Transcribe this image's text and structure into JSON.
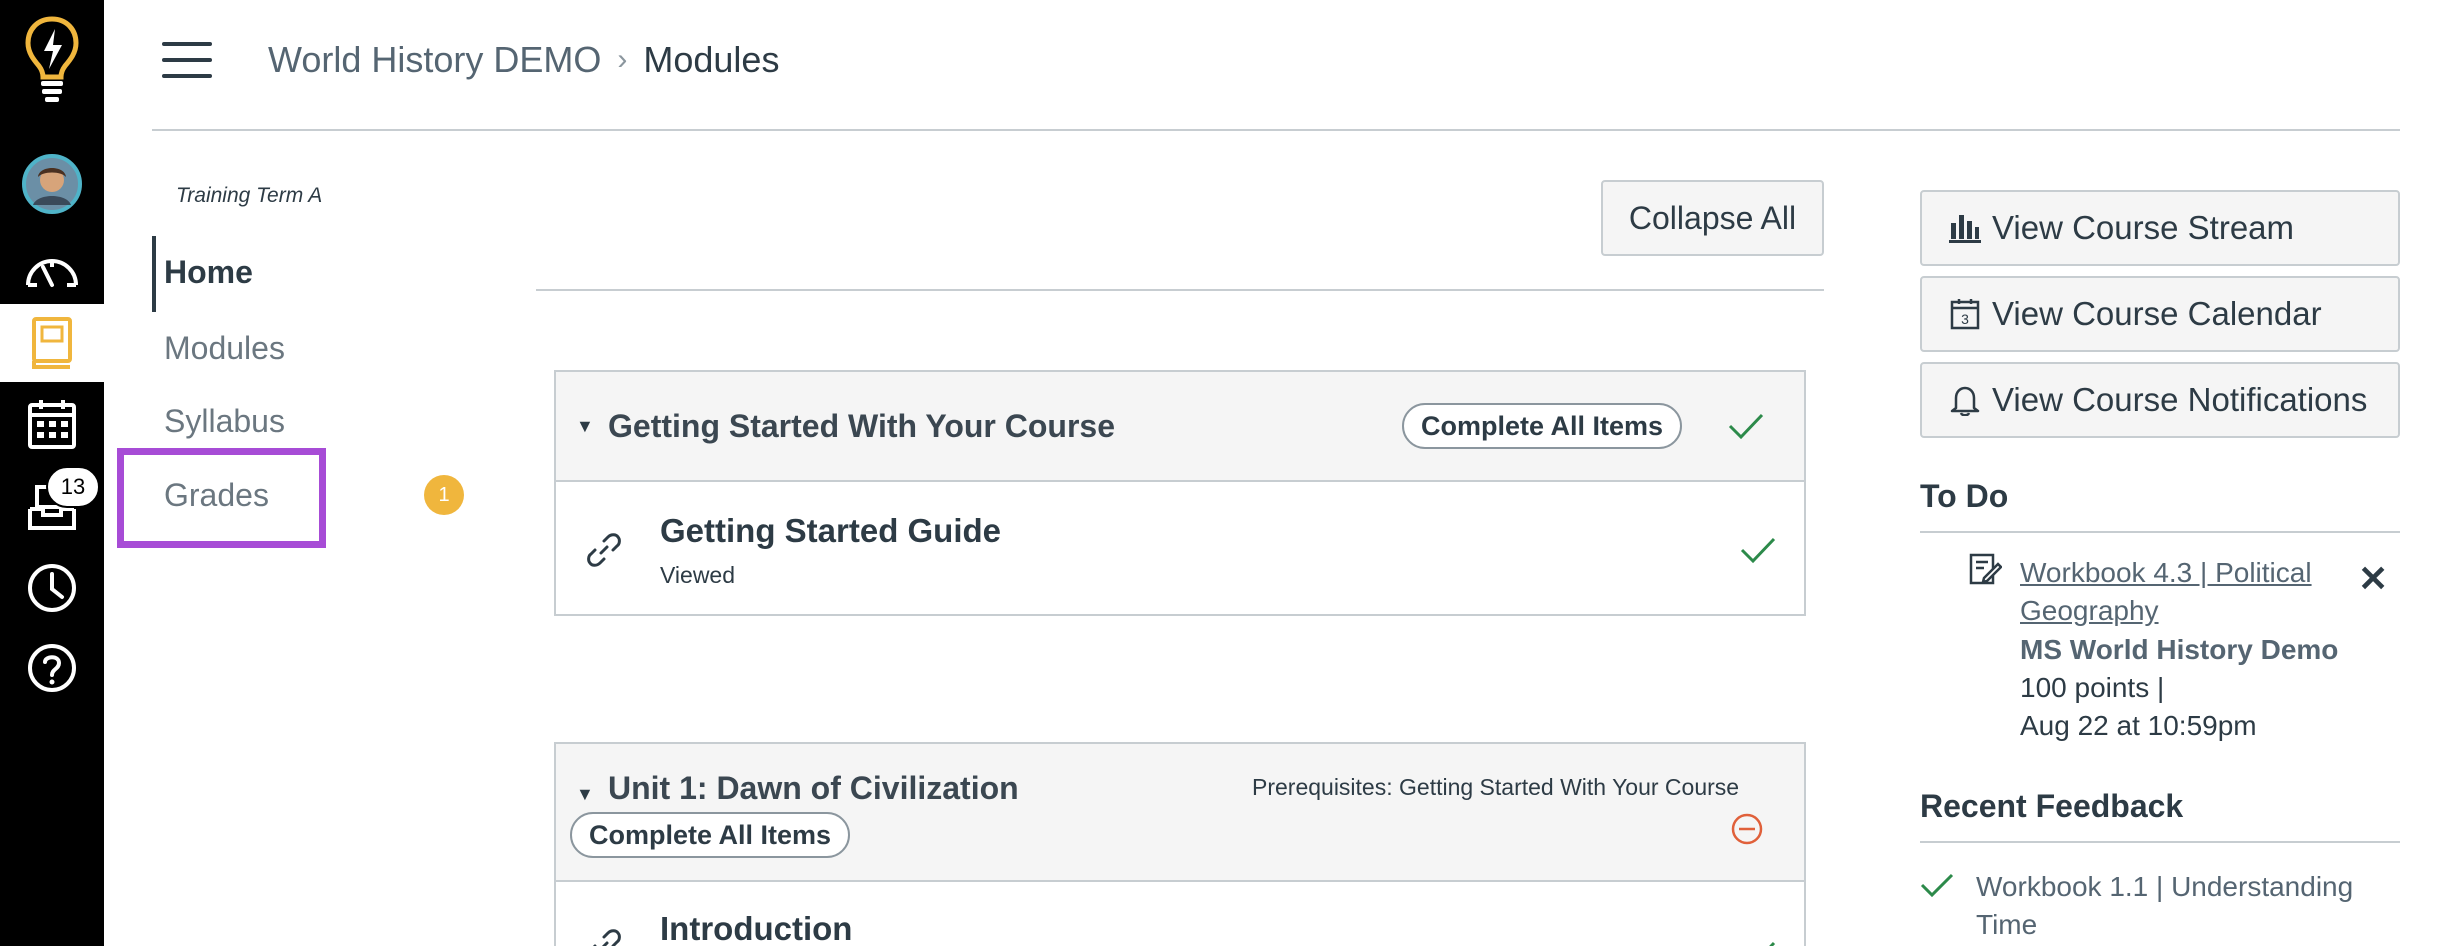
{
  "global_nav": {
    "items": [
      {
        "name": "logo",
        "icon": "lightbulb-icon"
      },
      {
        "name": "account",
        "icon": "avatar"
      },
      {
        "name": "dashboard",
        "icon": "dashboard-gauge-icon"
      },
      {
        "name": "courses",
        "icon": "courses-book-icon"
      },
      {
        "name": "calendar",
        "icon": "calendar-icon"
      },
      {
        "name": "inbox",
        "icon": "inbox-icon"
      },
      {
        "name": "history",
        "icon": "clock-icon"
      },
      {
        "name": "help",
        "icon": "help-circle-icon"
      }
    ],
    "inbox_count": "13",
    "accent_color": "#f0b63d"
  },
  "header": {
    "course": "World History DEMO",
    "separator": "›",
    "current": "Modules"
  },
  "course_nav": {
    "term": "Training Term A",
    "items": [
      {
        "label": "Home"
      },
      {
        "label": "Modules"
      },
      {
        "label": "Syllabus"
      },
      {
        "label": "Grades",
        "badge": "1"
      }
    ],
    "highlight_color": "#a74cd6"
  },
  "main": {
    "collapse_all": "Collapse All",
    "modules": [
      {
        "title": "Getting Started With Your Course",
        "complete_all": "Complete All Items",
        "status": "completed",
        "items": [
          {
            "title": "Getting Started Guide",
            "subtitle": "Viewed",
            "icon": "link-icon",
            "status": "completed"
          }
        ]
      },
      {
        "title": "Unit 1: Dawn of Civilization",
        "prerequisites": "Prerequisites: Getting Started With Your Course",
        "complete_all": "Complete All Items",
        "status": "locked",
        "items": [
          {
            "title": "Introduction",
            "icon": "link-icon",
            "status": "completed"
          }
        ]
      }
    ]
  },
  "sidebar": {
    "buttons": [
      {
        "label": "View Course Stream",
        "icon": "bar-chart-icon"
      },
      {
        "label": "View Course Calendar",
        "icon": "calendar-day-icon"
      },
      {
        "label": "View Course Notifications",
        "icon": "bell-icon"
      }
    ],
    "todo": {
      "heading": "To Do",
      "items": [
        {
          "title": "Workbook 4.3 | Political Geography",
          "course": "MS World History Demo",
          "points": "100 points  |",
          "due": "Aug 22 at 10:59pm",
          "dismiss": "✕"
        }
      ]
    },
    "recent_feedback": {
      "heading": "Recent Feedback",
      "items": [
        {
          "title": "Workbook 1.1 | Understanding Time"
        }
      ]
    }
  },
  "colors": {
    "success": "#2c8a4a",
    "warning": "#e0603a",
    "text": "#2d3b45"
  }
}
